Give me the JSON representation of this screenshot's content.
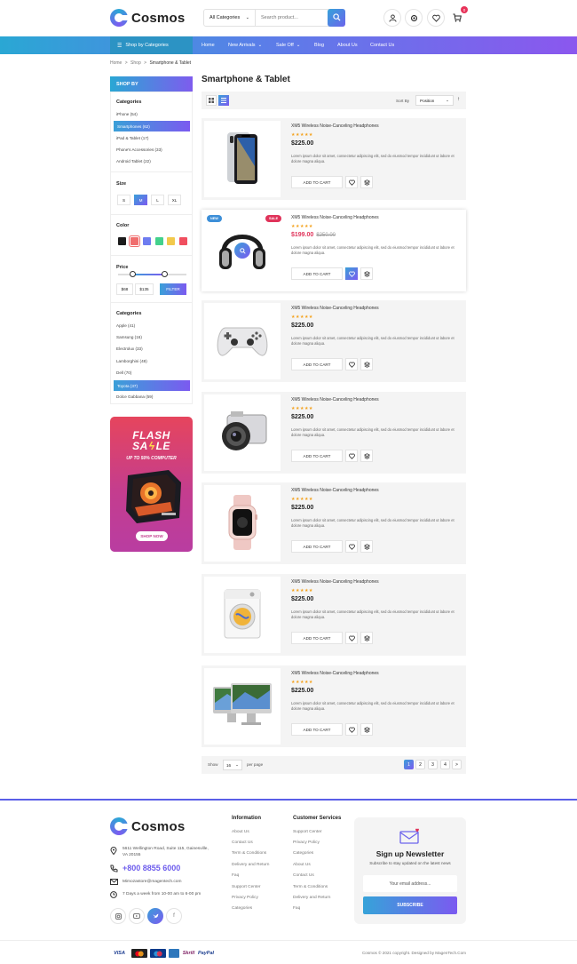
{
  "header": {
    "brand": "Cosmos",
    "search": {
      "category": "All Categories",
      "placeholder": "Search product..."
    },
    "cart_count": "0"
  },
  "nav": {
    "shop_by": "Shop by Categories",
    "items": [
      {
        "label": "Home"
      },
      {
        "label": "New Arrivals"
      },
      {
        "label": "Sale Off"
      },
      {
        "label": "Blog"
      },
      {
        "label": "About Us"
      },
      {
        "label": "Contact Us"
      }
    ]
  },
  "breadcrumb": {
    "home": "Home",
    "sep1": ">",
    "shop": "Shop",
    "sep2": ">",
    "current": "Smartphone & Tablet"
  },
  "sidebar": {
    "title": "SHOP BY",
    "categories_title": "Categories",
    "categories": [
      "iPhone (54)",
      "Smartphones (62)",
      "iPad & Tablet (17)",
      "Phone's Accessories (33)",
      "Android Tablet (22)"
    ],
    "size_title": "Size",
    "sizes": [
      "S",
      "M",
      "L",
      "XL"
    ],
    "color_title": "Color",
    "colors": [
      "#1c1c1c",
      "#f06e6e",
      "#6e7cf0",
      "#43d18c",
      "#f2c94c",
      "#f04f5f"
    ],
    "price_title": "Price",
    "price_min": "$68",
    "price_max": "$135",
    "filter_label": "FILTER",
    "brands_title": "Categories",
    "brands": [
      "Apple (41)",
      "Samsung (16)",
      "Electrolux (33)",
      "Lamborghini (48)",
      "Dell (70)",
      "Toyota (37)",
      "Dolce Gabbana (59)"
    ]
  },
  "promo": {
    "line1": "FLASH",
    "line2a": "SA",
    "line2b": "LE",
    "subtitle": "UP TO 50% COMPUTER",
    "button": "SHOP NOW"
  },
  "main": {
    "title": "Smartphone & Tablet",
    "sort_label": "Sort By",
    "sort_value": "Position"
  },
  "products": [
    {
      "name": "XM5 Wireless Noise-Canceling Headphones",
      "stars": "★★★★★",
      "price": "$225.00",
      "old_price": "",
      "desc": "Lorem ipsum dolor sit amet, consectetur adipiscing elit, sed do eiusmod tempor incididunt ut labore et dolore magna aliqua.",
      "cart": "ADD TO CART",
      "icon": "iphone"
    },
    {
      "name": "XM5 Wireless Noise-Canceling Headphones",
      "stars": "★★★★★",
      "price": "$199.00",
      "old_price": "$250.00",
      "desc": "Lorem ipsum dolor sit amet, consectetur adipiscing elit, sed do eiusmod tempor incididunt ut labore et dolore magna aliqua.",
      "cart": "ADD TO CART",
      "icon": "headphones",
      "badge_new": "NEW",
      "badge_sale": "SALE"
    },
    {
      "name": "XM5 Wireless Noise-Canceling Headphones",
      "stars": "★★★★★",
      "price": "$225.00",
      "old_price": "",
      "desc": "Lorem ipsum dolor sit amet, consectetur adipiscing elit, sed do eiusmod tempor incididunt ut labore et dolore magna aliqua.",
      "cart": "ADD TO CART",
      "icon": "gamepad"
    },
    {
      "name": "XM5 Wireless Noise-Canceling Headphones",
      "stars": "★★★★★",
      "price": "$225.00",
      "old_price": "",
      "desc": "Lorem ipsum dolor sit amet, consectetur adipiscing elit, sed do eiusmod tempor incididunt ut labore et dolore magna aliqua.",
      "cart": "ADD TO CART",
      "icon": "camera"
    },
    {
      "name": "XM5 Wireless Noise-Canceling Headphones",
      "stars": "★★★★★",
      "price": "$225.00",
      "old_price": "",
      "desc": "Lorem ipsum dolor sit amet, consectetur adipiscing elit, sed do eiusmod tempor incididunt ut labore et dolore magna aliqua.",
      "cart": "ADD TO CART",
      "icon": "watch"
    },
    {
      "name": "XM5 Wireless Noise-Canceling Headphones",
      "stars": "★★★★★",
      "price": "$225.00",
      "old_price": "",
      "desc": "Lorem ipsum dolor sit amet, consectetur adipiscing elit, sed do eiusmod tempor incididunt ut labore et dolore magna aliqua.",
      "cart": "ADD TO CART",
      "icon": "washer"
    },
    {
      "name": "XM5 Wireless Noise-Canceling Headphones",
      "stars": "★★★★★",
      "price": "$225.00",
      "old_price": "",
      "desc": "Lorem ipsum dolor sit amet, consectetur adipiscing elit, sed do eiusmod tempor incididunt ut labore et dolore magna aliqua.",
      "cart": "ADD TO CART",
      "icon": "imac"
    }
  ],
  "pagination": {
    "show_label": "Show",
    "per_page_value": "16",
    "per_page_label": "per page",
    "pages": [
      "1",
      "2",
      "3",
      "4"
    ],
    "next": ">"
  },
  "footer": {
    "brand": "Cosmos",
    "address": "5611 Wellington Road, Suite 115, Gainesville, VA 20155",
    "phone": "+800 8855 6000",
    "email": "Mimozastore@magentech.com",
    "hours": "7 Days a week from 10-00 am to 6-00 pm",
    "info_title": "Information",
    "info_links": [
      "About Us",
      "Contact Us",
      "Term & Conditions",
      "Delivery and Return",
      "Faq",
      "Support Center",
      "Privacy Policy",
      "Categories"
    ],
    "service_title": "Customer Services",
    "service_links": [
      "Support Center",
      "Privacy Policy",
      "Categories",
      "About Us",
      "Contact Us",
      "Term & Conditions",
      "Delivery and Return",
      "Faq"
    ],
    "newsletter": {
      "title": "Sign up Newsletter",
      "subtitle": "Subscribe to stay updated on the latest news",
      "placeholder": "Your email address...",
      "button": "SUBSCRIBE"
    },
    "copyright": "Cosmos © 2021 copyright. Designed by MagenTech.Com",
    "payments": [
      "VISA",
      "",
      "",
      "",
      "Skrill",
      "PayPal"
    ]
  },
  "colors": {
    "accent_blue": "#2aa7d4",
    "accent_purple": "#7b5cf0",
    "sale_red": "#e0335a",
    "star": "#f4a21d"
  }
}
